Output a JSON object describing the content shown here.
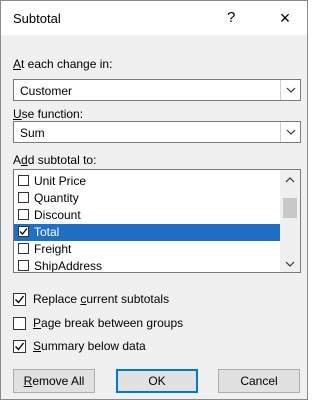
{
  "dialog": {
    "title": "Subtotal",
    "help": "?",
    "close": "×"
  },
  "at_each_change": {
    "label_accel": "A",
    "label_rest": "t each change in:",
    "value": "Customer"
  },
  "use_function": {
    "label_accel": "U",
    "label_rest": "se function:",
    "value": "Sum"
  },
  "add_subtotal": {
    "label_pre": "A",
    "label_accel": "d",
    "label_rest": "d subtotal to:",
    "items": [
      {
        "label": "Unit Price",
        "checked": false,
        "selected": false
      },
      {
        "label": "Quantity",
        "checked": false,
        "selected": false
      },
      {
        "label": "Discount",
        "checked": false,
        "selected": false
      },
      {
        "label": "Total",
        "checked": true,
        "selected": true
      },
      {
        "label": "Freight",
        "checked": false,
        "selected": false
      },
      {
        "label": "ShipAddress",
        "checked": false,
        "selected": false
      }
    ]
  },
  "options": {
    "replace": {
      "pre": "Replace ",
      "accel": "c",
      "rest": "urrent subtotals",
      "checked": true
    },
    "page_break": {
      "pre": "",
      "accel": "P",
      "rest": "age break between groups",
      "checked": false
    },
    "summary": {
      "pre": "",
      "accel": "S",
      "rest": "ummary below data",
      "checked": true
    }
  },
  "buttons": {
    "remove_accel": "R",
    "remove_rest": "emove All",
    "ok": "OK",
    "cancel": "Cancel"
  }
}
